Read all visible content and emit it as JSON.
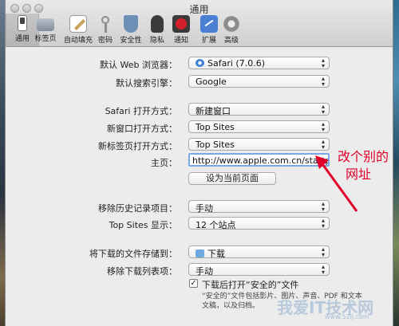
{
  "window": {
    "title": "通用"
  },
  "toolbar": [
    {
      "label": "通用",
      "icon": "switch-icon",
      "color": "#5a5a5a"
    },
    {
      "label": "标签页",
      "icon": "tabs-icon",
      "color": "#7f8c9a"
    },
    {
      "label": "自动填充",
      "icon": "pencil-icon",
      "color": "#c9a35a"
    },
    {
      "label": "密码",
      "icon": "key-icon",
      "color": "#8e8e8e"
    },
    {
      "label": "安全性",
      "icon": "shield-icon",
      "color": "#6d8fb7"
    },
    {
      "label": "隐私",
      "icon": "hand-icon",
      "color": "#3b3b3b"
    },
    {
      "label": "通知",
      "icon": "notification-icon",
      "color": "#d3202a"
    },
    {
      "label": "扩展",
      "icon": "puzzle-icon",
      "color": "#4a7fd4"
    },
    {
      "label": "高级",
      "icon": "gear-icon",
      "color": "#8d8d8d"
    }
  ],
  "form": {
    "default_browser": {
      "label": "默认 Web 浏览器：",
      "value": "Safari (7.0.6)"
    },
    "search_engine": {
      "label": "默认搜索引擎：",
      "value": "Google"
    },
    "safari_opens": {
      "label": "Safari 打开方式：",
      "value": "新建窗口"
    },
    "new_window_opens": {
      "label": "新窗口打开方式：",
      "value": "Top Sites"
    },
    "new_tab_opens": {
      "label": "新标签页打开方式：",
      "value": "Top Sites"
    },
    "homepage": {
      "label": "主页：",
      "value": "http://www.apple.com.cn/startpage/"
    },
    "set_current_button": "设为当前页面",
    "remove_history": {
      "label": "移除历史记录项目：",
      "value": "手动"
    },
    "top_sites_show": {
      "label": "Top Sites 显示：",
      "value": "12 个站点"
    },
    "download_location": {
      "label": "将下载的文件存储到：",
      "value": "下载"
    },
    "remove_download": {
      "label": "移除下载列表项：",
      "value": "手动"
    },
    "open_safe_files": {
      "label": "下载后打开“安全的”文件",
      "checked": true,
      "note_line1": "“安全的”文件包括影片、图片、声音、PDF 和文本",
      "note_line2": "文稿，以及归档。"
    }
  },
  "annotation": {
    "line1": "改个别的",
    "line2": "网址",
    "color": "#e0002a"
  },
  "watermark": {
    "text": "我爱IT技术网",
    "url": "www.52ij.com"
  }
}
